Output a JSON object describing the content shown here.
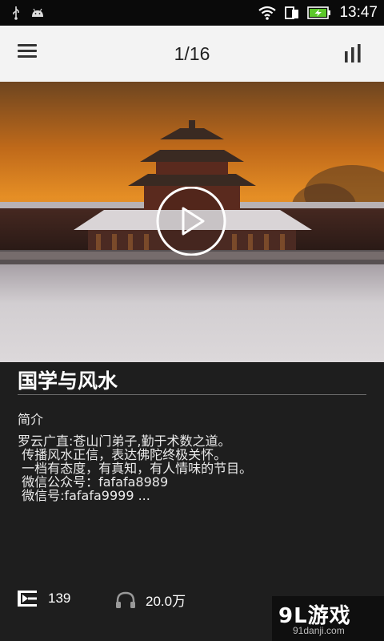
{
  "status_bar": {
    "time": "13:47",
    "icons": [
      "usb-icon",
      "android-icon",
      "wifi-icon",
      "sim-icon",
      "battery-charging-icon"
    ]
  },
  "top_bar": {
    "page_indicator": "1/16",
    "menu_icon": "hamburger-menu-icon",
    "stats_icon": "bar-chart-icon"
  },
  "hero": {
    "play_icon": "play-icon"
  },
  "program": {
    "title": "国学与风水",
    "intro_label": "简介",
    "description_lines": [
      "罗云广直:苍山门弟子,勤于术数之道。",
      " 传播风水正信，表达佛陀终极关怀。",
      " 一档有态度，有真知，有人情味的节目。",
      " 微信公众号：fafafa8989",
      " 微信号:fafafa9999 ..."
    ]
  },
  "stats": {
    "episodes": "139",
    "listens": "20.0万",
    "episodes_icon": "playlist-icon",
    "listens_icon": "headphones-icon"
  },
  "watermark": {
    "logo": "9L游戏",
    "url": "91danji.com"
  },
  "colors": {
    "status_bar_bg": "#0a0a0a",
    "top_bar_bg": "#f3f3f3",
    "content_bg": "#1e1e1e",
    "battery_green": "#5cc82a"
  }
}
